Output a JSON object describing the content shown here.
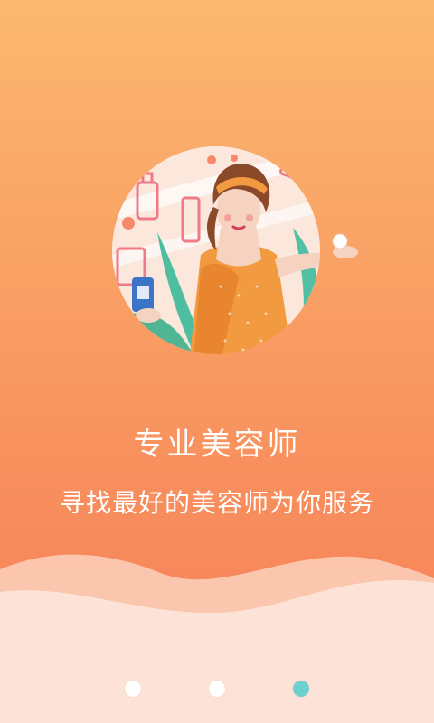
{
  "onboarding": {
    "title": "专业美容师",
    "subtitle": "寻找最好的美容师为你服务",
    "page_indicator": {
      "total": 3,
      "current": 3,
      "active_color": "#6ecfcf",
      "inactive_color": "#ffffff"
    },
    "illustration": {
      "icon": "beautician-illustration"
    },
    "colors": {
      "background_top": "#fbb86f",
      "background_bottom": "#f5815a",
      "wave_light": "#fde3d7",
      "wave_mid": "#fbcdb6"
    }
  }
}
